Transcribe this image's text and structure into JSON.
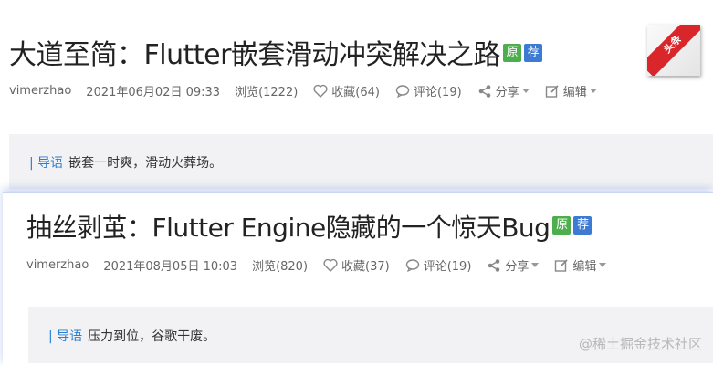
{
  "article1": {
    "title": "大道至简：Flutter嵌套滑动冲突解决之路",
    "badge_original": "原",
    "badge_recommended": "荐",
    "author": "vimerzhao",
    "date": "2021年06月02日 09:33",
    "views": "浏览(1222)",
    "favorites": "收藏(64)",
    "comments": "评论(19)",
    "share": "分享",
    "edit": "编辑",
    "intro_tag": "| 导语",
    "intro_text": "嵌套一时爽，滑动火葬场。",
    "ribbon": "头条"
  },
  "article2": {
    "title": "抽丝剥茧：Flutter Engine隐藏的一个惊天Bug",
    "badge_original": "原",
    "badge_recommended": "荐",
    "author": "vimerzhao",
    "date": "2021年08月05日 10:03",
    "views": "浏览(820)",
    "favorites": "收藏(37)",
    "comments": "评论(19)",
    "share": "分享",
    "edit": "编辑",
    "intro_tag": "| 导语",
    "intro_text": "压力到位，谷歌干废。"
  },
  "watermark": "@稀土掘金技术社区",
  "icons": [
    "heart-icon",
    "comment-icon",
    "share-icon",
    "edit-icon",
    "caret-down-icon"
  ],
  "colors": {
    "badge_original": "#4cae4c",
    "badge_recommended": "#3c7ad3",
    "intro_tag": "#2a7fd4",
    "ribbon": "#d8262b"
  }
}
